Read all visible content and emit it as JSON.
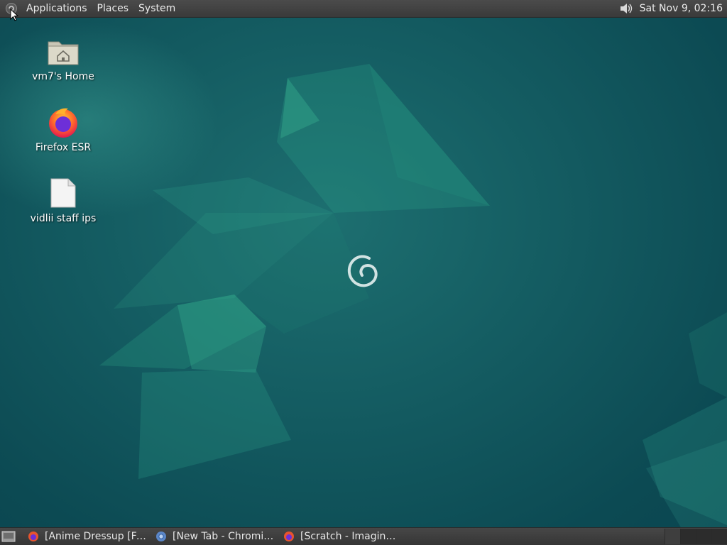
{
  "top_panel": {
    "menus": [
      "Applications",
      "Places",
      "System"
    ],
    "clock": "Sat Nov 9, 02:16",
    "icons": {
      "menu_logo": "gnome-foot-icon",
      "volume": "volume-icon"
    }
  },
  "desktop": {
    "icons": [
      {
        "label": "vm7's Home",
        "icon": "home-folder-icon"
      },
      {
        "label": "Firefox ESR",
        "icon": "firefox-icon"
      },
      {
        "label": "vidlii staff ips",
        "icon": "text-file-icon"
      }
    ],
    "wallpaper_logo": "debian-swirl-icon"
  },
  "bottom_panel": {
    "show_desktop_icon": "show-desktop-icon",
    "tasks": [
      {
        "label": "[Anime Dressup [Fem...",
        "icon": "firefox-icon"
      },
      {
        "label": "[New Tab - Chromium]",
        "icon": "chromium-icon"
      },
      {
        "label": "[Scratch - Imagine, Pr...",
        "icon": "firefox-icon"
      }
    ]
  },
  "colors": {
    "panel": "#3e3e3e",
    "wallpaper": "#135a60",
    "accent": "#1f8a7a"
  }
}
